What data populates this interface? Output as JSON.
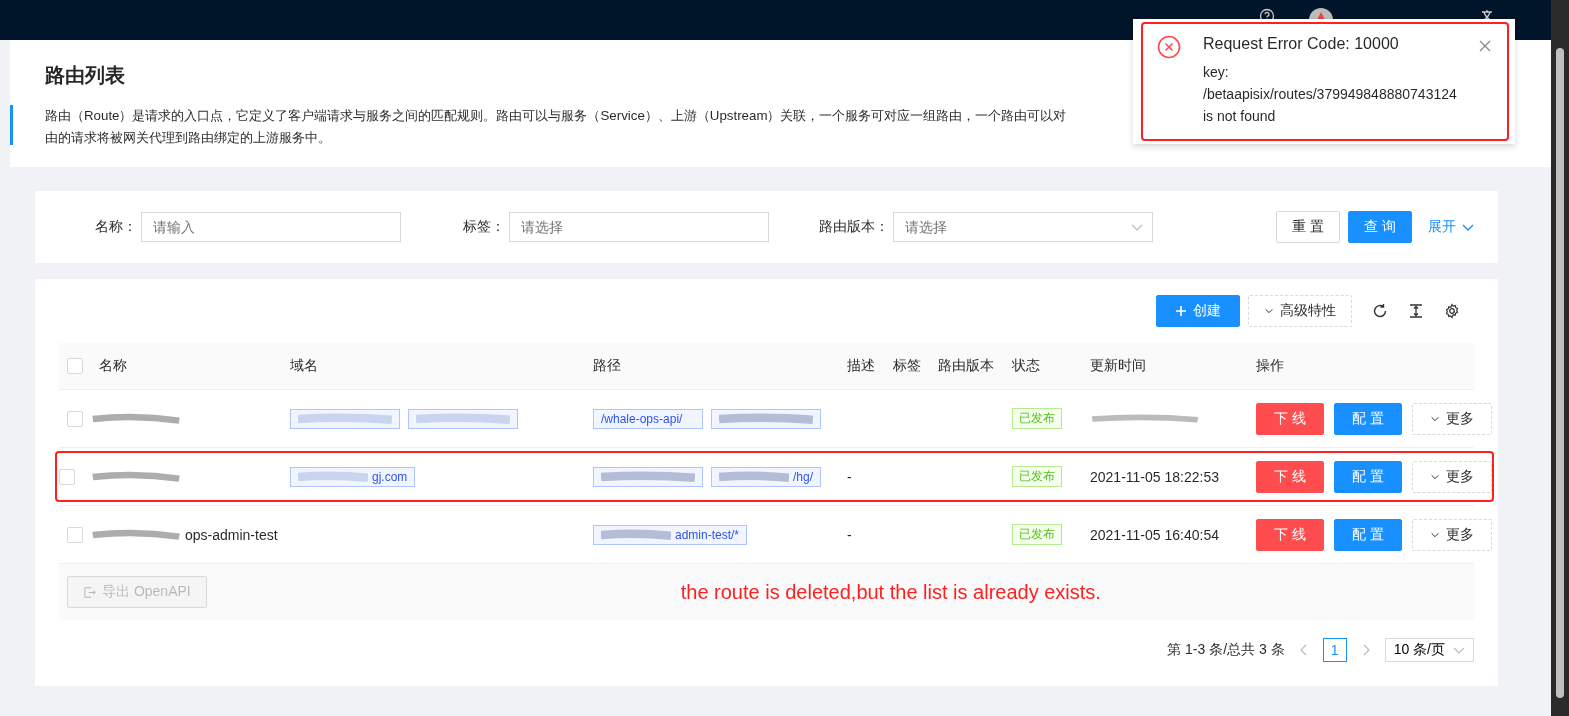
{
  "page": {
    "title": "路由列表",
    "description": [
      "路由（Route）是请求的入口点，它定义了客户端请求与服务之间的匹配规则。路由可以与服务（Service）、上游（Upstream）关联，一个服务可对应一组路由，一个路由可以对",
      "由的请求将被网关代理到路由绑定的上游服务中。"
    ]
  },
  "filters": [
    {
      "label": "名称：",
      "placeholder": "请输入",
      "kind": "input"
    },
    {
      "label": "标签：",
      "placeholder": "请选择",
      "kind": "select"
    },
    {
      "label": "路由版本：",
      "placeholder": "请选择",
      "kind": "select"
    }
  ],
  "filter_buttons": {
    "reset": "重 置",
    "query": "查 询",
    "expand": "展开"
  },
  "toolbar": {
    "create": "创建",
    "advanced": "高级特性"
  },
  "table": {
    "select_all": {
      "checked": false
    },
    "columns": [
      "名称",
      "域名",
      "路径",
      "描述",
      "标签",
      "路由版本",
      "状态",
      "更新时间",
      "操作"
    ],
    "rows": [
      {
        "checked": false,
        "name": {
          "redacted": true
        },
        "hosts": [
          {
            "redacted": true
          },
          {
            "redacted": true
          }
        ],
        "paths": [
          {
            "text": "/whale-ops-api/"
          },
          {
            "redacted": true
          }
        ],
        "status": {
          "text": "已发布",
          "kind": "success"
        },
        "time": {
          "redacted": true
        },
        "actions": {
          "offline": "下 线",
          "config": "配 置",
          "more": "更多"
        }
      },
      {
        "checked": false,
        "highlighted": true,
        "name": {
          "redacted": true
        },
        "hosts": [
          {
            "text": "gj.com",
            "redacted": true
          }
        ],
        "paths": [
          {
            "redacted": true
          },
          {
            "text": "/hg/",
            "redacted": true
          }
        ],
        "description": {
          "text": "-"
        },
        "status": {
          "text": "已发布",
          "kind": "success"
        },
        "time": {
          "text": "2021-11-05 18:22:53"
        },
        "actions": {
          "offline": "下 线",
          "config": "配 置",
          "more": "更多"
        }
      },
      {
        "checked": false,
        "name": {
          "text": "ops-admin-test",
          "redacted": true
        },
        "hosts": [],
        "paths": [
          {
            "text": "admin-test/*",
            "redacted": true
          }
        ],
        "description": {
          "text": "-"
        },
        "status": {
          "text": "已发布",
          "kind": "success"
        },
        "time": {
          "text": "2021-11-05 16:40:54"
        },
        "actions": {
          "offline": "下 线",
          "config": "配 置",
          "more": "更多"
        }
      }
    ]
  },
  "export_button": {
    "text": "导出 OpenAPI",
    "disabled": true
  },
  "annotation": "the route is deleted,but the list is already exists.",
  "pagination": {
    "summary": "第 1-3 条/总共 3 条",
    "pages": [
      {
        "text": "1",
        "selected": true
      }
    ],
    "page_size": "10 条/页"
  },
  "toast": {
    "title": "Request Error Code: 10000",
    "lines": [
      "key:",
      "/betaapisix/routes/379949848880743124",
      "is not found"
    ],
    "highlighted": true
  }
}
